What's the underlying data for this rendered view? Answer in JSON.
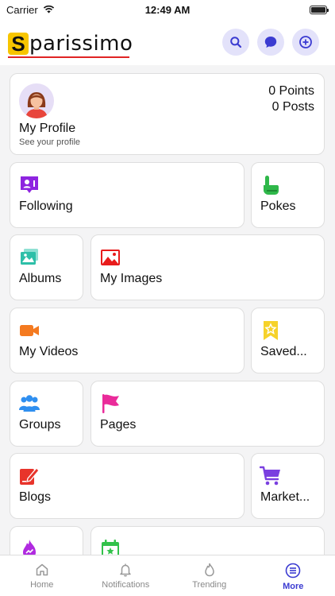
{
  "status": {
    "carrier": "Carrier",
    "time": "12:49 AM"
  },
  "header": {
    "logo_first": "S",
    "logo_rest": "parissimo",
    "accent": "#3b3bd1"
  },
  "profile": {
    "name": "My Profile",
    "subtitle": "See your profile",
    "points": "0 Points",
    "posts": "0 Posts"
  },
  "menu": {
    "following": "Following",
    "pokes": "Pokes",
    "albums": "Albums",
    "my_images": "My Images",
    "my_videos": "My Videos",
    "saved": "Saved...",
    "groups": "Groups",
    "pages": "Pages",
    "blogs": "Blogs",
    "market": "Market..."
  },
  "tabs": [
    {
      "label": "Home",
      "icon": "home-icon"
    },
    {
      "label": "Notifications",
      "icon": "bell-icon"
    },
    {
      "label": "Trending",
      "icon": "flame-icon"
    },
    {
      "label": "More",
      "icon": "menu-icon"
    }
  ]
}
